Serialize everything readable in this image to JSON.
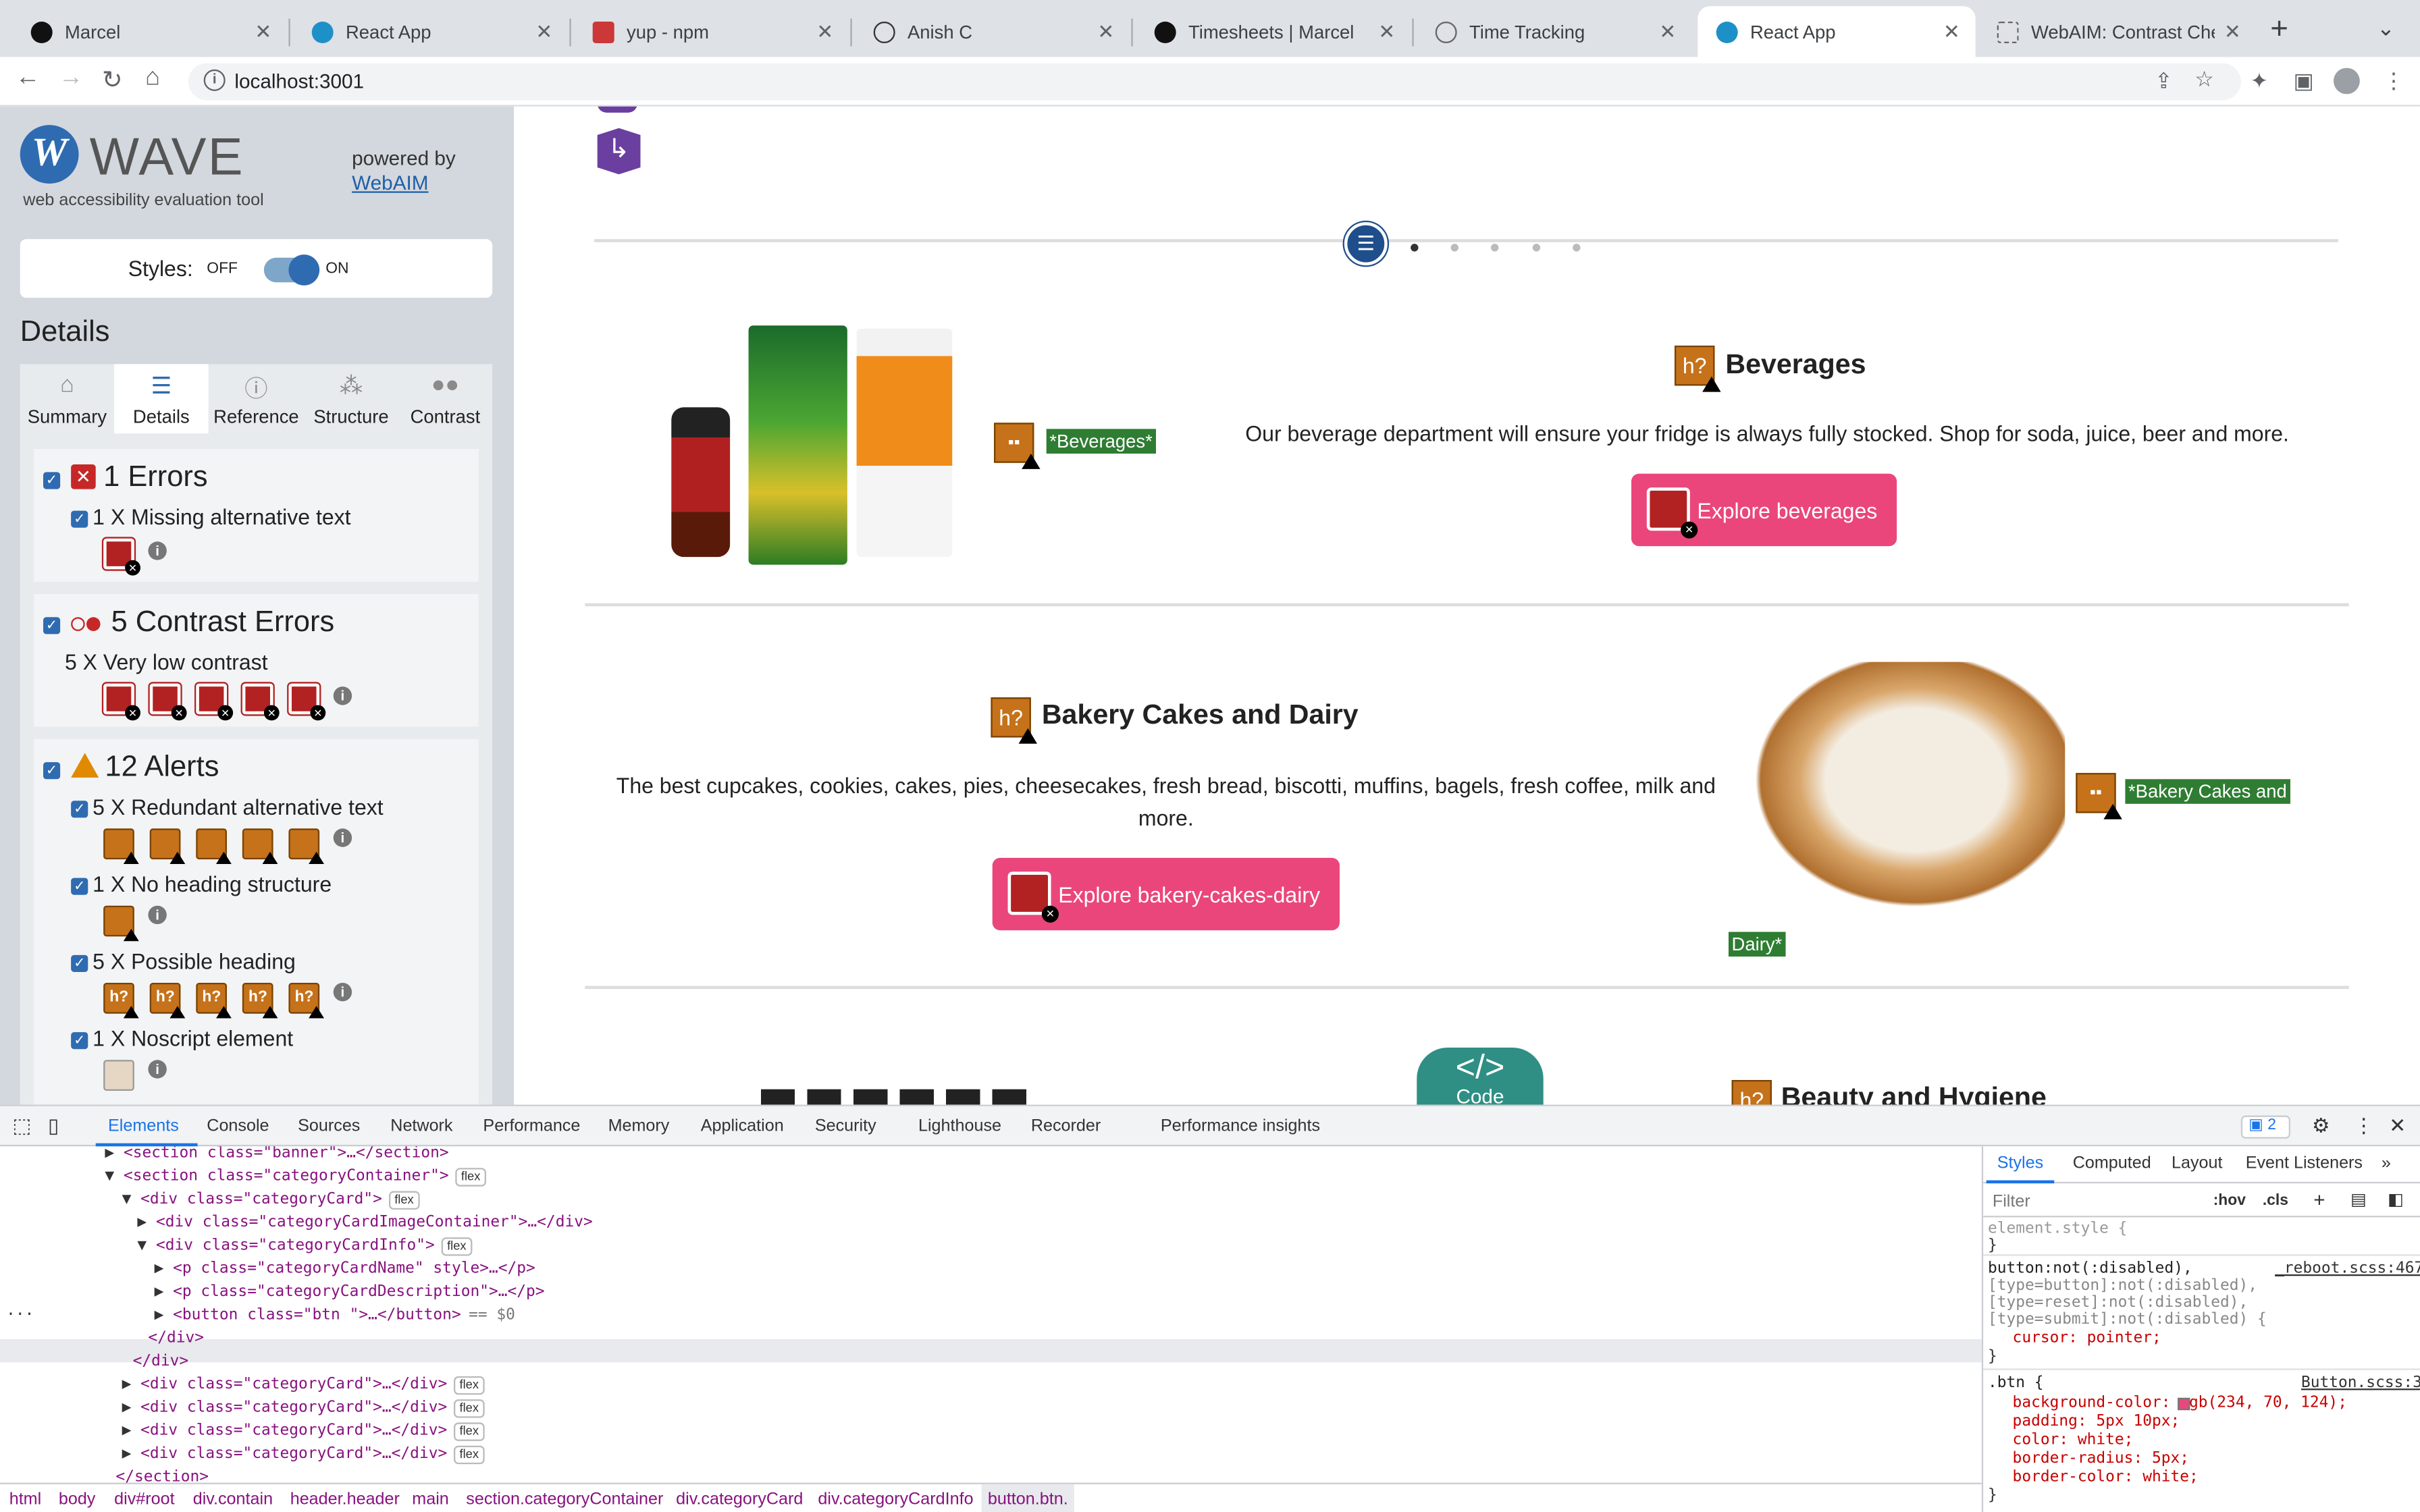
{
  "browser": {
    "tabs": [
      {
        "title": "Marcel",
        "fav": "#111111"
      },
      {
        "title": "React App",
        "fav": "#1e90c8"
      },
      {
        "title": "yup - npm",
        "fav": "#cb3837"
      },
      {
        "title": "Anish C",
        "fav": "#ffffff"
      },
      {
        "title": "Timesheets | Marcel",
        "fav": "#111111"
      },
      {
        "title": "Time Tracking",
        "fav": "#888888"
      },
      {
        "title": "React App",
        "fav": "#1e90c8"
      },
      {
        "title": "WebAIM: Contrast Checker",
        "fav": "#888888"
      }
    ],
    "new_tab": "+",
    "url": "localhost:3001"
  },
  "wave": {
    "logo_letter": "W",
    "title": "WAVE",
    "subtitle": "web accessibility evaluation tool",
    "powered_by": "powered by",
    "webaim": "WebAIM",
    "styles_label": "Styles:",
    "off": "OFF",
    "on": "ON",
    "details_heading": "Details",
    "tabs": [
      "Summary",
      "Details",
      "Reference",
      "Structure",
      "Contrast"
    ],
    "errors": {
      "title": "1 Errors",
      "item": "1 X Missing alternative text"
    },
    "contrast": {
      "title": "5 Contrast Errors",
      "item": "5 X Very low contrast"
    },
    "alerts": {
      "title": "12 Alerts",
      "items": [
        "5 X Redundant alternative text",
        "1 X No heading structure",
        "5 X Possible heading",
        "1 X Noscript element"
      ]
    }
  },
  "page": {
    "categories": [
      {
        "name": "Beverages",
        "desc": "Our beverage department will ensure your fridge is always fully stocked. Shop for soda, juice, beer and more.",
        "button": "Explore beverages",
        "alt": "*Beverages*"
      },
      {
        "name": "Bakery Cakes and Dairy",
        "desc1": "The best cupcakes, cookies, cakes, pies, cheesecakes, fresh bread, biscotti, muffins, bagels, fresh coffee, milk and",
        "desc2": "more.",
        "button": "Explore bakery-cakes-dairy",
        "alt1": "*Bakery Cakes and",
        "alt2": "Dairy*"
      },
      {
        "name": "Beauty and Hygiene"
      }
    ],
    "code_label": "Code"
  },
  "devtools": {
    "tabs": [
      "Elements",
      "Console",
      "Sources",
      "Network",
      "Performance",
      "Memory",
      "Application",
      "Security",
      "Lighthouse",
      "Recorder",
      "Performance insights"
    ],
    "issues": "2",
    "dom": [
      "<section class=\"banner\">…</section>",
      "<section class=\"categoryContainer\">",
      "<div class=\"categoryCard\">",
      "<div class=\"categoryCardImageContainer\">…</div>",
      "<div class=\"categoryCardInfo\">",
      "<p class=\"categoryCardName\" style>…</p>",
      "<p class=\"categoryCardDescription\">…</p>",
      "<button class=\"btn \">…</button>",
      "</div>",
      "</div>",
      "<div class=\"categoryCard\">…</div>",
      "<div class=\"categoryCard\">…</div>",
      "<div class=\"categoryCard\">…</div>",
      "<div class=\"categoryCard\">…</div>",
      "</section>"
    ],
    "flex": "flex",
    "selected_suffix": "== $0",
    "breadcrumbs": [
      "html",
      "body",
      "div#root",
      "div.contain",
      "header.header",
      "main",
      "section.categoryContainer",
      "div.categoryCard",
      "div.categoryCardInfo",
      "button.btn."
    ],
    "styles_tabs": [
      "Styles",
      "Computed",
      "Layout",
      "Event Listeners"
    ],
    "filter_placeholder": "Filter",
    "hov": ":hov",
    "cls": ".cls",
    "element_style": "element.style {",
    "rule1": {
      "selector": "button:not(:disabled),",
      "sel2": "[type=button]:not(:disabled),",
      "sel3": "[type=reset]:not(:disabled),",
      "sel4": "[type=submit]:not(:disabled) {",
      "source": "_reboot.scss:467",
      "decl": "cursor: pointer;"
    },
    "rule2": {
      "selector": ".btn {",
      "source": "Button.scss:3",
      "decls": [
        "background-color: rgb(234, 70, 124);",
        "padding: 5px 10px;",
        "color: white;",
        "border-radius: 5px;",
        "border-color: white;"
      ]
    }
  }
}
